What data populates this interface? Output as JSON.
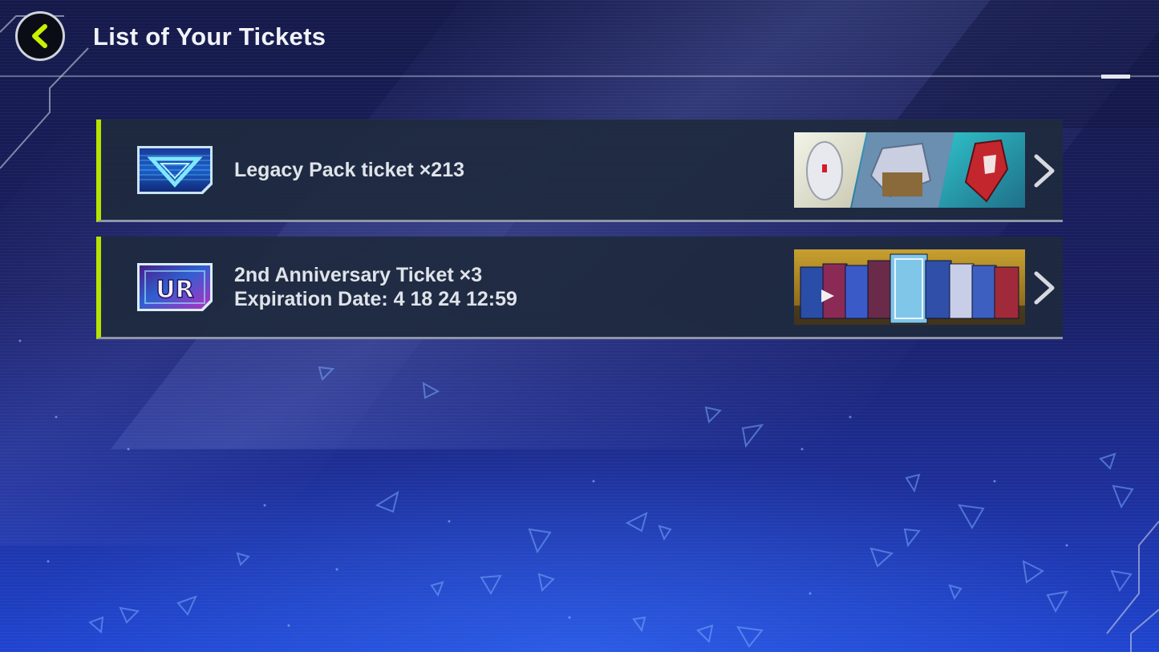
{
  "header": {
    "title": "List of Your Tickets"
  },
  "tickets": [
    {
      "name": "Legacy Pack ticket",
      "count_text": "×213",
      "line1": "Legacy Pack ticket ×213",
      "icon": "legacy-pack-ticket-icon",
      "banner": "legacy-pack-banner"
    },
    {
      "name": "2nd Anniversary Ticket",
      "count_text": "×3",
      "line1": "2nd Anniversary Ticket ×3",
      "line2": "Expiration Date: 4 18 24 12:59",
      "icon": "ur-ticket-icon",
      "icon_text": "UR",
      "banner": "anniversary-pack-banner"
    }
  ],
  "colors": {
    "accent": "#b6e300",
    "panel": "#1e2a3e",
    "back_arrow": "#c8f000"
  }
}
